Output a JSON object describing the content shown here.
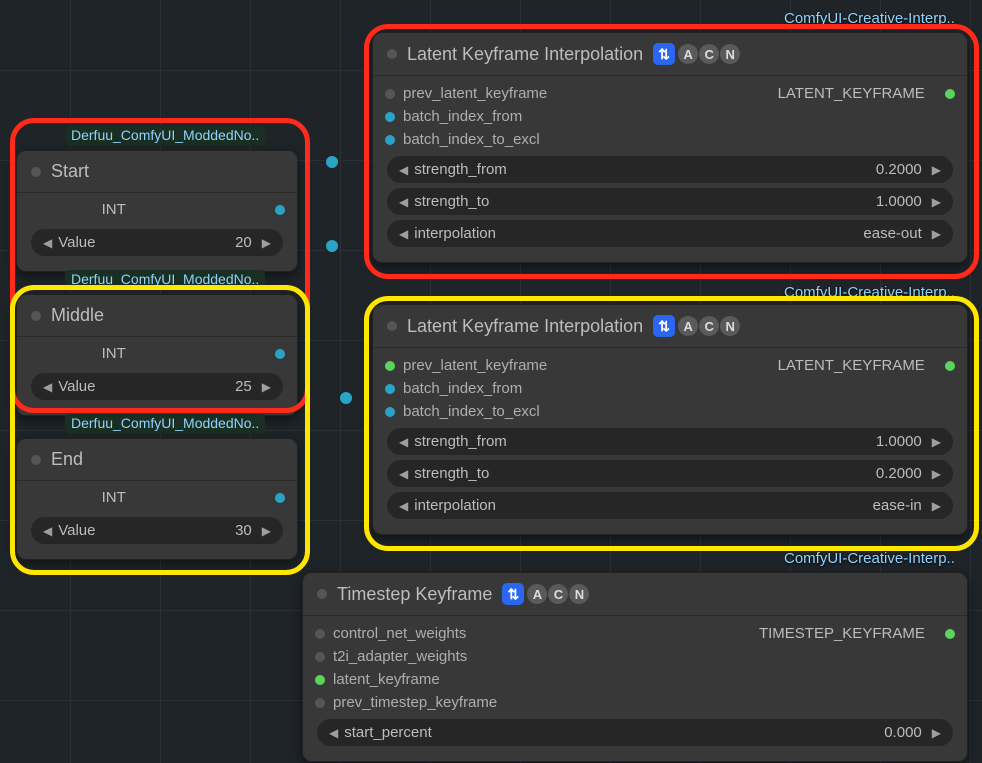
{
  "tags": {
    "derfuu": "Derfuu_ComfyUI_ModdedNo..",
    "creative": "ComfyUI-Creative-Interp.."
  },
  "start_node": {
    "title": "Start",
    "out_type": "INT",
    "value_label": "Value",
    "value": "20"
  },
  "middle_node": {
    "title": "Middle",
    "out_type": "INT",
    "value_label": "Value",
    "value": "25"
  },
  "end_node": {
    "title": "End",
    "out_type": "INT",
    "value_label": "Value",
    "value": "30"
  },
  "lki1": {
    "title": "Latent Keyframe Interpolation",
    "inputs": {
      "a": "prev_latent_keyframe",
      "b": "batch_index_from",
      "c": "batch_index_to_excl"
    },
    "output": "LATENT_KEYFRAME",
    "strength_from_label": "strength_from",
    "strength_from": "0.2000",
    "strength_to_label": "strength_to",
    "strength_to": "1.0000",
    "interp_label": "interpolation",
    "interp": "ease-out"
  },
  "lki2": {
    "title": "Latent Keyframe Interpolation",
    "inputs": {
      "a": "prev_latent_keyframe",
      "b": "batch_index_from",
      "c": "batch_index_to_excl"
    },
    "output": "LATENT_KEYFRAME",
    "strength_from_label": "strength_from",
    "strength_from": "1.0000",
    "strength_to_label": "strength_to",
    "strength_to": "0.2000",
    "interp_label": "interpolation",
    "interp": "ease-in"
  },
  "tk": {
    "title": "Timestep Keyframe",
    "inputs": {
      "a": "control_net_weights",
      "b": "t2i_adapter_weights",
      "c": "latent_keyframe",
      "d": "prev_timestep_keyframe"
    },
    "output": "TIMESTEP_KEYFRAME",
    "start_percent_label": "start_percent",
    "start_percent": "0.000"
  }
}
